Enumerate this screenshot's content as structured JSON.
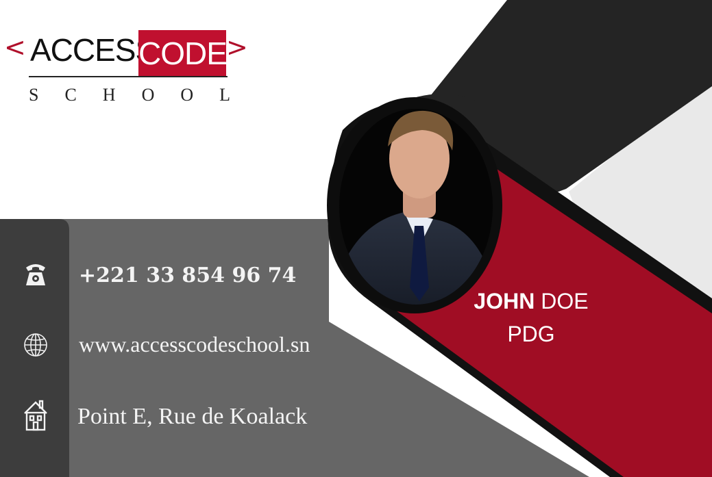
{
  "brand": {
    "bracket_left": "<",
    "word_one": "ACCESS",
    "word_two": "CODE",
    "bracket_right": ">",
    "subtitle": "SCHOOL"
  },
  "contact": {
    "phone": "+221 33 854 96 74",
    "website": "www.accesscodeschool.sn",
    "address": "Point E, Rue de Koalack"
  },
  "person": {
    "first_name": "JOHN",
    "last_name": "DOE",
    "role": "PDG"
  },
  "icons": {
    "phone": "phone-icon",
    "website": "globe-icon",
    "address": "home-icon"
  },
  "colors": {
    "brand_red": "#c0102f",
    "card_red": "#a00d24",
    "dark": "#242424",
    "grey_panel": "#666666",
    "side_strip": "#3d3d3d"
  }
}
